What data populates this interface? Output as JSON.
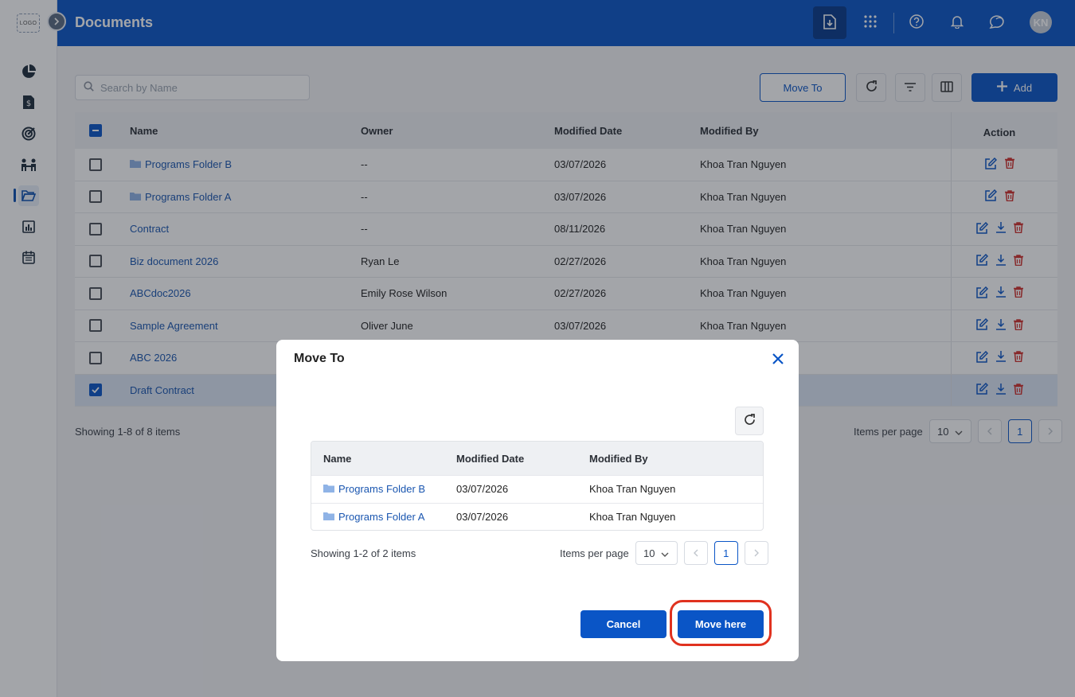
{
  "app": {
    "logo_text": "LOGO",
    "page_title": "Documents"
  },
  "header": {
    "avatar_initials": "KN",
    "icons": [
      "document-download-icon",
      "apps-grid-icon",
      "help-icon",
      "bell-icon",
      "chat-icon"
    ]
  },
  "sidebar": {
    "items": [
      {
        "icon": "pie-chart-icon"
      },
      {
        "icon": "invoice-icon"
      },
      {
        "icon": "target-icon"
      },
      {
        "icon": "team-icon"
      },
      {
        "icon": "folder-open-icon",
        "active": true
      },
      {
        "icon": "report-chart-icon"
      },
      {
        "icon": "calendar-icon"
      }
    ]
  },
  "toolbar": {
    "search_placeholder": "Search by Name",
    "move_to_label": "Move To",
    "add_label": "Add"
  },
  "table": {
    "columns": {
      "name": "Name",
      "owner": "Owner",
      "modified_date": "Modified Date",
      "modified_by": "Modified By",
      "action": "Action"
    },
    "rows": [
      {
        "name": "Programs Folder B",
        "owner": "--",
        "modified_date": "03/07/2026",
        "modified_by": "Khoa Tran Nguyen"
      },
      {
        "name": "Programs Folder A",
        "owner": "--",
        "modified_date": "03/07/2026",
        "modified_by": "Khoa Tran Nguyen"
      },
      {
        "name": "Contract",
        "owner": "--",
        "modified_date": "08/11/2026",
        "modified_by": "Khoa Tran Nguyen"
      },
      {
        "name": "Biz document 2026",
        "owner": "Ryan Le",
        "modified_date": "02/27/2026",
        "modified_by": "Khoa Tran Nguyen"
      },
      {
        "name": "ABCdoc2026",
        "owner": "Emily Rose Wilson",
        "modified_date": "02/27/2026",
        "modified_by": "Khoa Tran Nguyen"
      },
      {
        "name": "Sample Agreement",
        "owner": "Oliver June",
        "modified_date": "03/07/2026",
        "modified_by": "Khoa Tran Nguyen"
      },
      {
        "name": "ABC 2026",
        "owner": "",
        "modified_date": "",
        "modified_by": ""
      },
      {
        "name": "Draft Contract",
        "owner": "",
        "modified_date": "",
        "modified_by": ""
      }
    ],
    "showing": "Showing 1-8 of 8 items",
    "items_per_page_label": "Items per page",
    "items_per_page": "10",
    "current_page": "1"
  },
  "modal": {
    "title": "Move To",
    "columns": {
      "name": "Name",
      "modified_date": "Modified Date",
      "modified_by": "Modified By"
    },
    "rows": [
      {
        "name": "Programs Folder B",
        "modified_date": "03/07/2026",
        "modified_by": "Khoa Tran Nguyen"
      },
      {
        "name": "Programs Folder A",
        "modified_date": "03/07/2026",
        "modified_by": "Khoa Tran Nguyen"
      }
    ],
    "showing": "Showing 1-2 of 2 items",
    "items_per_page_label": "Items per page",
    "items_per_page": "10",
    "current_page": "1",
    "cancel_label": "Cancel",
    "move_here_label": "Move here"
  },
  "colors": {
    "primary": "#0a55c6",
    "header": "#0a55c6",
    "danger": "#d0312d",
    "highlight": "#e0321f"
  }
}
